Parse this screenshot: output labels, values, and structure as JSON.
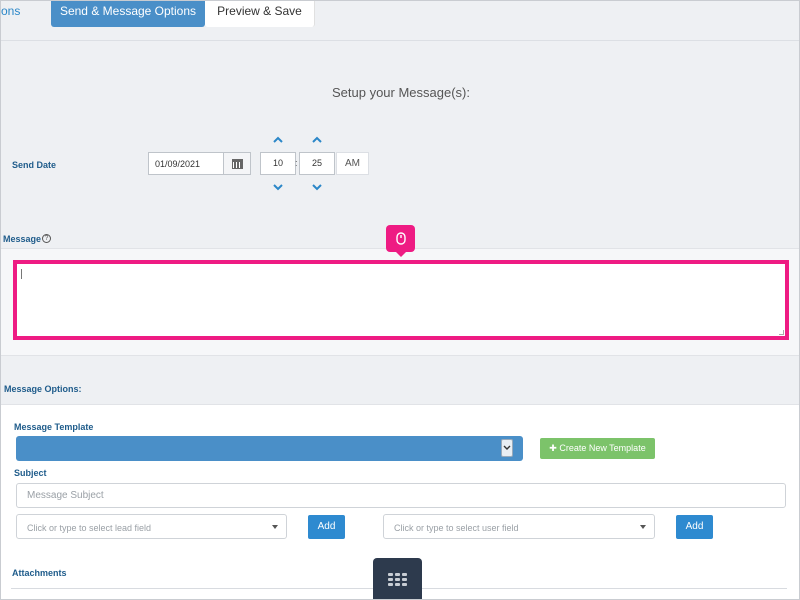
{
  "tabs": {
    "prev_label": "ons",
    "active_label": "Send & Message Options",
    "next_label": "Preview & Save"
  },
  "setup": {
    "title": "Setup your Message(s):"
  },
  "send_date": {
    "label": "Send Date",
    "date_value": "01/09/2021",
    "hour": "10",
    "separator": ":",
    "minute": "25",
    "meridiem": "AM"
  },
  "message": {
    "label": "Message",
    "help_glyph": "?",
    "value": ""
  },
  "options": {
    "section_label": "Message Options:",
    "template_label": "Message Template",
    "template_value": "",
    "create_template_label": "✚ Create New Template",
    "subject_label": "Subject",
    "subject_placeholder": "Message Subject",
    "lead_field_placeholder": "Click or type to select lead field",
    "lead_add_label": "Add",
    "user_field_placeholder": "Click or type to select user field",
    "user_add_label": "Add",
    "attachments_label": "Attachments"
  },
  "colors": {
    "accent": "#4a8fc8",
    "highlight": "#ee1b83",
    "label": "#1f5c8b",
    "success": "#7cc36a",
    "button": "#2e8ad0"
  },
  "icons": {
    "date": "calendar-icon",
    "up": "chevron-up-icon",
    "down": "chevron-down-icon",
    "pointer": "mouse-icon",
    "panel_handle": "grid-icon"
  }
}
